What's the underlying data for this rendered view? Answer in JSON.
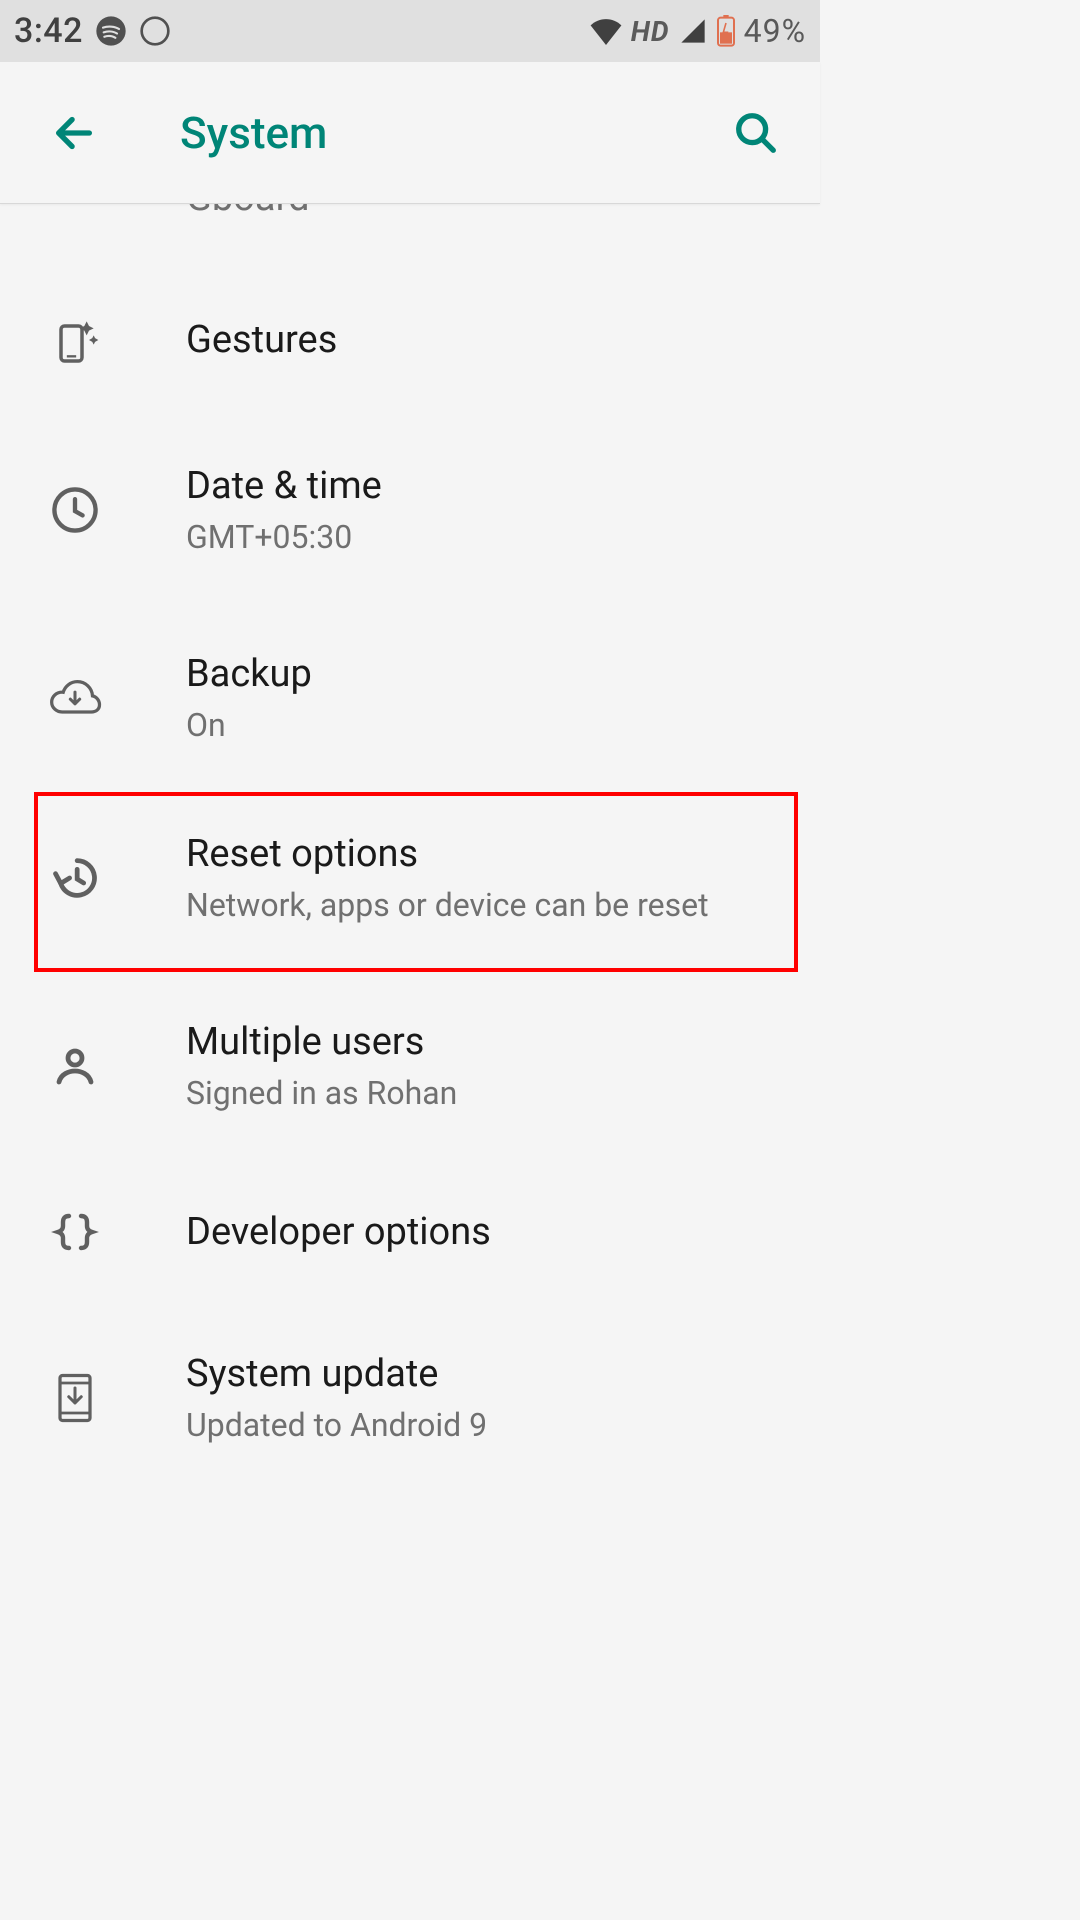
{
  "status": {
    "time": "3:42",
    "hd": "HD",
    "battery_pct": "49%"
  },
  "appbar": {
    "title": "System"
  },
  "items": {
    "cutoff": "Gboard",
    "gestures": {
      "title": "Gestures"
    },
    "datetime": {
      "title": "Date & time",
      "sub": "GMT+05:30"
    },
    "backup": {
      "title": "Backup",
      "sub": "On"
    },
    "reset": {
      "title": "Reset options",
      "sub": "Network, apps or device can be reset"
    },
    "users": {
      "title": "Multiple users",
      "sub": "Signed in as Rohan"
    },
    "dev": {
      "title": "Developer options"
    },
    "update": {
      "title": "System update",
      "sub": "Updated to Android 9"
    }
  }
}
